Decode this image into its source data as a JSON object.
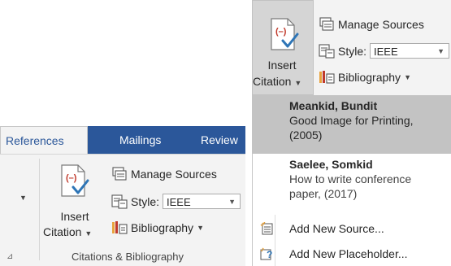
{
  "ribbon": {
    "tabs": [
      {
        "label": "References",
        "active": true
      },
      {
        "label": "Mailings",
        "active": false
      },
      {
        "label": "Review",
        "active": false
      }
    ],
    "insert_citation": {
      "line1": "Insert",
      "line2": "Citation"
    },
    "manage_sources": "Manage Sources",
    "style_label": "Style:",
    "style_value": "IEEE",
    "bibliography": "Bibliography",
    "group_label": "Citations & Bibliography"
  },
  "popup": {
    "insert_citation": {
      "line1": "Insert",
      "line2": "Citation"
    },
    "manage_sources": "Manage Sources",
    "style_label": "Style:",
    "style_value": "IEEE",
    "bibliography": "Bibliography",
    "citations": [
      {
        "author": "Meankid, Bundit",
        "title_line1": "Good Image for Printing,",
        "title_line2": "(2005)",
        "selected": true
      },
      {
        "author": "Saelee, Somkid",
        "title_line1": "How to write conference",
        "title_line2": "paper, (2017)",
        "selected": false
      }
    ],
    "menu": {
      "add_new_source": "Add New Source...",
      "add_new_placeholder": "Add New Placeholder..."
    }
  },
  "colors": {
    "tab_bar": "#2b579a",
    "ribbon_bg": "#f3f3f3",
    "selected_item": "#c3c3c3",
    "icon_red": "#c0392b",
    "icon_blue": "#2e75b6"
  }
}
